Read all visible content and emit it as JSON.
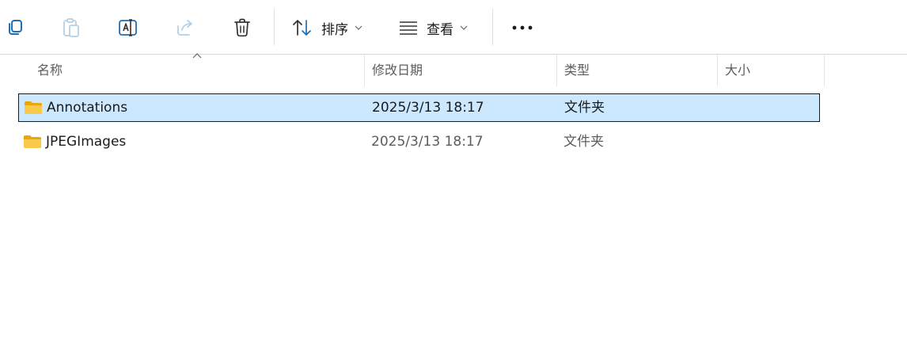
{
  "toolbar": {
    "sort_label": "排序",
    "view_label": "查看"
  },
  "columns": {
    "name": "名称",
    "modified": "修改日期",
    "type": "类型",
    "size": "大小"
  },
  "rows": [
    {
      "name": "Annotations",
      "modified": "2025/3/13 18:17",
      "type": "文件夹",
      "selected": true
    },
    {
      "name": "JPEGImages",
      "modified": "2025/3/13 18:17",
      "type": "文件夹",
      "selected": false
    }
  ],
  "colors": {
    "selection_bg": "#cce8ff",
    "folder_yellow": "#f8c94a",
    "accent_blue": "#1e6fb8"
  }
}
